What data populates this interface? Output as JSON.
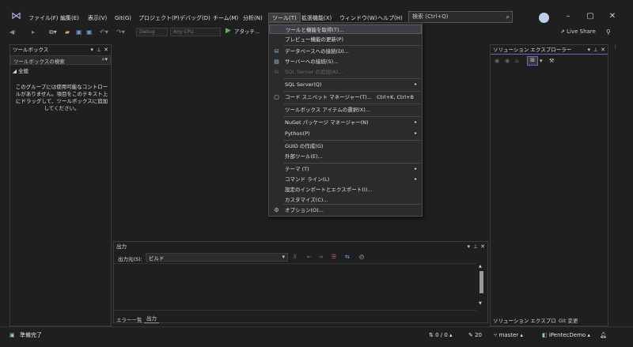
{
  "menubar": {
    "file": "ファイル(F)",
    "edit": "編集(E)",
    "view": "表示(V)",
    "git": "Git(G)",
    "project": "プロジェクト(P)",
    "debug": "デバッグ(D)",
    "team": "チーム(M)",
    "analyze": "分析(N)",
    "tools": "ツール(T)",
    "extensions": "拡張機能(X)",
    "window": "ウィンドウ(W)",
    "help": "ヘルプ(H)"
  },
  "search": {
    "label": "検索 (Ctrl+Q)"
  },
  "toolbar": {
    "config": "Debug",
    "platform": "Any CPU",
    "attach": "アタッチ...",
    "live_share": "Live Share"
  },
  "toolbox": {
    "title": "ツールボックス",
    "search_placeholder": "ツールボックスの検索",
    "group": "全般",
    "empty_message": "このグループには使用可能なコントロールがありません。項目をこのテキスト上にドラッグして、ツールボックスに追加してください。"
  },
  "tools_menu": {
    "items": [
      {
        "label": "ツールと機能を取得(T)...",
        "shortcut": "",
        "submenu": false,
        "disabled": false,
        "highlight": true,
        "icon": ""
      },
      {
        "label": "プレビュー機能の更新(P)",
        "shortcut": "",
        "submenu": false,
        "disabled": false,
        "highlight": false,
        "icon": ""
      },
      {
        "label": "データベースへの接続(D)...",
        "shortcut": "",
        "submenu": false,
        "disabled": false,
        "highlight": false,
        "icon": "database-connect-icon"
      },
      {
        "label": "サーバーへの接続(S)...",
        "shortcut": "",
        "submenu": false,
        "disabled": false,
        "highlight": false,
        "icon": "server-connect-icon"
      },
      {
        "label": "SQL Server の追加(A)...",
        "shortcut": "",
        "submenu": false,
        "disabled": true,
        "highlight": false,
        "icon": "sql-server-icon"
      },
      {
        "label": "SQL Server(Q)",
        "shortcut": "",
        "submenu": true,
        "disabled": false,
        "highlight": false,
        "icon": ""
      },
      {
        "label": "コード スニペット マネージャー(T)...",
        "shortcut": "Ctrl+K, Ctrl+B",
        "submenu": false,
        "disabled": false,
        "highlight": false,
        "icon": "snippet-icon"
      },
      {
        "label": "ツールボックス アイテムの選択(X)...",
        "shortcut": "",
        "submenu": false,
        "disabled": false,
        "highlight": false,
        "icon": ""
      },
      {
        "label": "NuGet パッケージ マネージャー(N)",
        "shortcut": "",
        "submenu": true,
        "disabled": false,
        "highlight": false,
        "icon": ""
      },
      {
        "label": "Python(P)",
        "shortcut": "",
        "submenu": true,
        "disabled": false,
        "highlight": false,
        "icon": ""
      },
      {
        "label": "GUID の作成(G)",
        "shortcut": "",
        "submenu": false,
        "disabled": false,
        "highlight": false,
        "icon": ""
      },
      {
        "label": "外部ツール(E)...",
        "shortcut": "",
        "submenu": false,
        "disabled": false,
        "highlight": false,
        "icon": ""
      },
      {
        "label": "テーマ (T)",
        "shortcut": "",
        "submenu": true,
        "disabled": false,
        "highlight": false,
        "icon": ""
      },
      {
        "label": "コマンド ライン(L)",
        "shortcut": "",
        "submenu": true,
        "disabled": false,
        "highlight": false,
        "icon": ""
      },
      {
        "label": "設定のインポートとエクスポート(I)...",
        "shortcut": "",
        "submenu": false,
        "disabled": false,
        "highlight": false,
        "icon": ""
      },
      {
        "label": "カスタマイズ(C)...",
        "shortcut": "",
        "submenu": false,
        "disabled": false,
        "highlight": false,
        "icon": ""
      },
      {
        "label": "オプション(O)...",
        "shortcut": "",
        "submenu": false,
        "disabled": false,
        "highlight": false,
        "icon": "gear-icon"
      }
    ]
  },
  "solution_explorer": {
    "title": "ソリューション エクスプローラー",
    "tab_solution": "ソリューション エクスプローラー",
    "tab_git": "Git 変更"
  },
  "output": {
    "title": "出力",
    "source_label": "出力元(S):",
    "source_value": "ビルド",
    "tab_errors": "エラー一覧",
    "tab_output": "出力"
  },
  "statusbar": {
    "status": "準備完了",
    "changes": "0 / 0",
    "commits": "20",
    "branch": "master",
    "repo": "iPentecDemo"
  }
}
